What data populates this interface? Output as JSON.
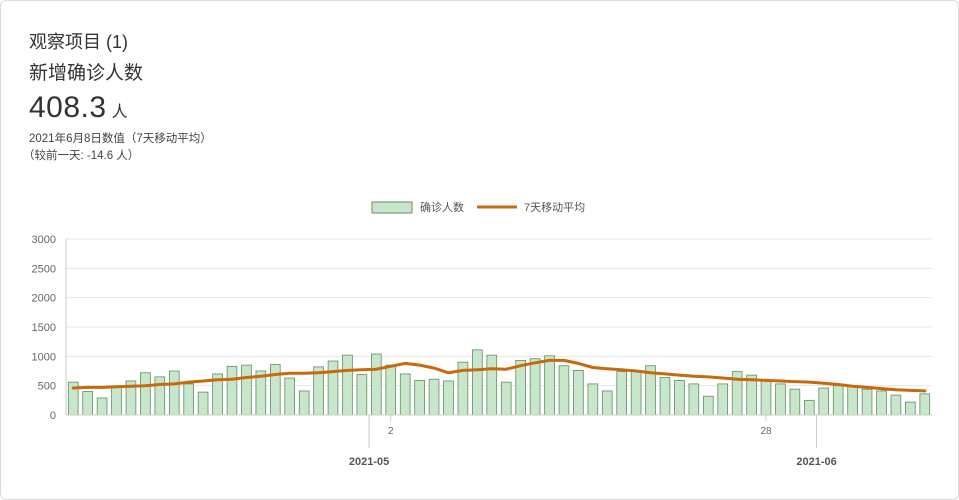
{
  "card": {
    "group_title": "观察项目 (1)",
    "metric_title": "新增确诊人数",
    "value": "408.3",
    "unit": "人",
    "date_line": "2021年6月8日数值（7天移动平均）",
    "compare_line": "（较前一天: -14.6 人）"
  },
  "colors": {
    "bar_fill": "#c8e6c9",
    "bar_stroke": "#5f8f62",
    "line": "#c8690e",
    "grid": "#e6e6e6",
    "text": "#333333"
  },
  "chart_data": {
    "type": "bar",
    "title": "",
    "legend_position": "top-center",
    "grid": true,
    "ylim": [
      0,
      3000
    ],
    "yticks": [
      "0",
      "500",
      "1000",
      "1500",
      "2000",
      "2500",
      "3000"
    ],
    "x_ticks_minor": [
      {
        "index": 22,
        "label": "2"
      },
      {
        "index": 48,
        "label": "28"
      }
    ],
    "x_ticks_major": [
      {
        "index": 21,
        "label": "2021-05"
      },
      {
        "index": 52,
        "label": "2021-06"
      }
    ],
    "series": [
      {
        "name": "确诊人数",
        "type": "bar",
        "values": [
          560,
          400,
          290,
          480,
          580,
          720,
          650,
          750,
          530,
          390,
          700,
          830,
          850,
          750,
          860,
          630,
          410,
          820,
          920,
          1020,
          690,
          1040,
          850,
          700,
          590,
          610,
          580,
          900,
          1110,
          1020,
          560,
          930,
          960,
          1010,
          840,
          760,
          530,
          410,
          740,
          750,
          840,
          640,
          590,
          530,
          320,
          530,
          740,
          680,
          600,
          530,
          440,
          250,
          460,
          500,
          490,
          440,
          410,
          340,
          220,
          360
        ]
      },
      {
        "name": "7天移动平均",
        "type": "line",
        "values": [
          460,
          470,
          470,
          480,
          490,
          500,
          520,
          530,
          560,
          580,
          600,
          610,
          640,
          660,
          690,
          710,
          710,
          720,
          740,
          760,
          770,
          780,
          830,
          880,
          850,
          800,
          720,
          760,
          770,
          790,
          780,
          840,
          890,
          930,
          930,
          880,
          810,
          790,
          770,
          750,
          720,
          700,
          680,
          660,
          650,
          630,
          610,
          600,
          590,
          580,
          570,
          560,
          540,
          520,
          490,
          470,
          450,
          430,
          420,
          410
        ]
      }
    ]
  }
}
